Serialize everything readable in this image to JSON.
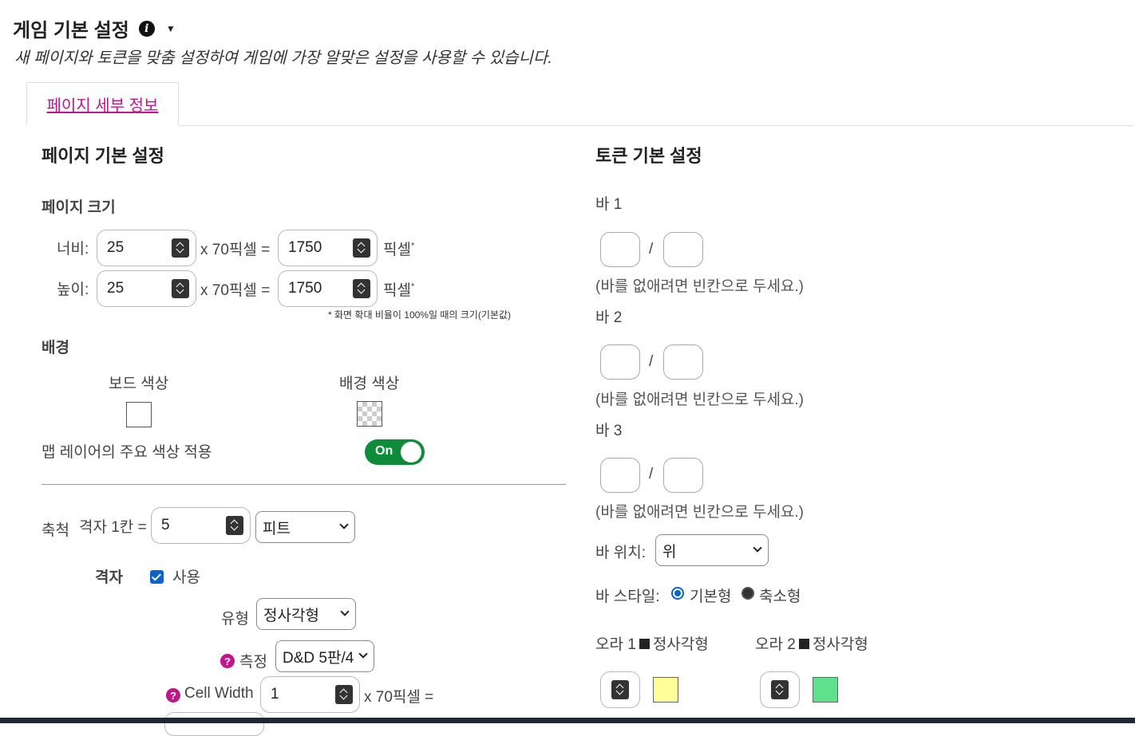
{
  "header": {
    "title": "게임 기본 설정",
    "subtitle": "새 페이지와 토큰을 맞춤 설정하여 게임에 가장 알맞은 설정을 사용할 수 있습니다."
  },
  "tabs": [
    {
      "label": "페이지 세부 정보"
    }
  ],
  "page_settings": {
    "heading": "페이지 기본 설정",
    "size": {
      "heading": "페이지 크기",
      "width_label": "너비:",
      "width_value": "25",
      "width_px": "1750",
      "height_label": "높이:",
      "height_value": "25",
      "height_px": "1750",
      "multiplier": "x 70픽셀 =",
      "pixel_unit": "픽셀",
      "asterisk": "*",
      "footnote": "* 화면 확대 비율이 100%일 때의 크기(기본값)"
    },
    "background": {
      "heading": "배경",
      "board_color_label": "보드 색상",
      "board_color": "#ffffff",
      "bg_color_label": "배경 색상",
      "map_layer_label": "맵 레이어의 주요 색상 적용",
      "toggle_label": "On"
    },
    "scale": {
      "label": "축척",
      "cell_label": "격자 1칸 =",
      "cell_value": "5",
      "unit_value": "피트"
    },
    "grid": {
      "label": "격자",
      "enabled_label": "사용",
      "type_label": "유형",
      "type_value": "정사각형",
      "measure_label": "측정",
      "measure_value": "D&D 5판/4",
      "cell_width_label": "Cell Width",
      "cell_width_value": "1",
      "cell_width_multiplier": "x 70픽셀 ="
    }
  },
  "token_settings": {
    "heading": "토큰 기본 설정",
    "bars": [
      {
        "label": "바 1",
        "separator": "/",
        "hint": "(바를 없애려면 빈칸으로 두세요.)"
      },
      {
        "label": "바 2",
        "separator": "/",
        "hint": "(바를 없애려면 빈칸으로 두세요.)"
      },
      {
        "label": "바 3",
        "separator": "/",
        "hint": "(바를 없애려면 빈칸으로 두세요.)"
      }
    ],
    "bar_position_label": "바 위치:",
    "bar_position_value": "위",
    "bar_style_label": "바 스타일:",
    "bar_style_options": [
      "기본형",
      "축소형"
    ],
    "aura1": {
      "label": "오라 1",
      "shape": "정사각형",
      "color": "#ffff99"
    },
    "aura2": {
      "label": "오라 2",
      "shape": "정사각형",
      "color": "#5fe08a"
    }
  }
}
